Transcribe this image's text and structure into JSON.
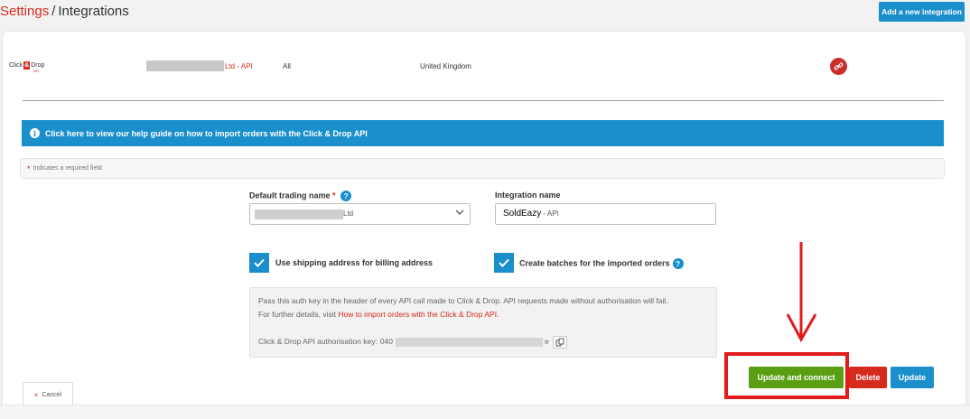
{
  "breadcrumb": {
    "parent": "Settings",
    "separator": "/",
    "current": "Integrations"
  },
  "header": {
    "add_button": "Add a new integration"
  },
  "integration": {
    "logo_text_1": "Click",
    "logo_amp": "&",
    "logo_text_2": "Drop",
    "logo_sub": "API",
    "name_suffix": "Ltd - API",
    "scope": "All",
    "country": "United Kingdom"
  },
  "help_banner": {
    "text": "Click here to view our help guide on how to import orders with the Click & Drop API"
  },
  "required_note": {
    "star": "*",
    "text": "Indicates a required field"
  },
  "form": {
    "trading_name": {
      "label": "Default trading name",
      "required_star": "*",
      "help": "?",
      "value_suffix": "Ltd"
    },
    "integration_name": {
      "label": "Integration name",
      "typed_value": "SoldEazy",
      "suffix": "- API"
    },
    "use_shipping_for_billing": {
      "label": "Use shipping address for billing address",
      "checked": true
    },
    "create_batches": {
      "label": "Create batches for the imported orders",
      "checked": true,
      "help": "?"
    }
  },
  "auth_info": {
    "line1": "Pass this auth key in the header of every API call made to Click & Drop. API requests made without authorisation will fail.",
    "line2_prefix": "For further details, visit",
    "line2_link": "How to import orders with the Click & Drop API.",
    "key_label": "Click & Drop API authorisation key:",
    "key_start": "040",
    "key_end": "e"
  },
  "actions": {
    "update_connect": "Update and connect",
    "delete": "Delete",
    "update": "Update"
  },
  "cancel": {
    "icon": "×",
    "label": "Cancel"
  },
  "colors": {
    "brand_red": "#d52b1e",
    "primary_blue": "#1a8fcb",
    "success_green": "#5a9e13",
    "annotation_red": "#e31b1b"
  }
}
